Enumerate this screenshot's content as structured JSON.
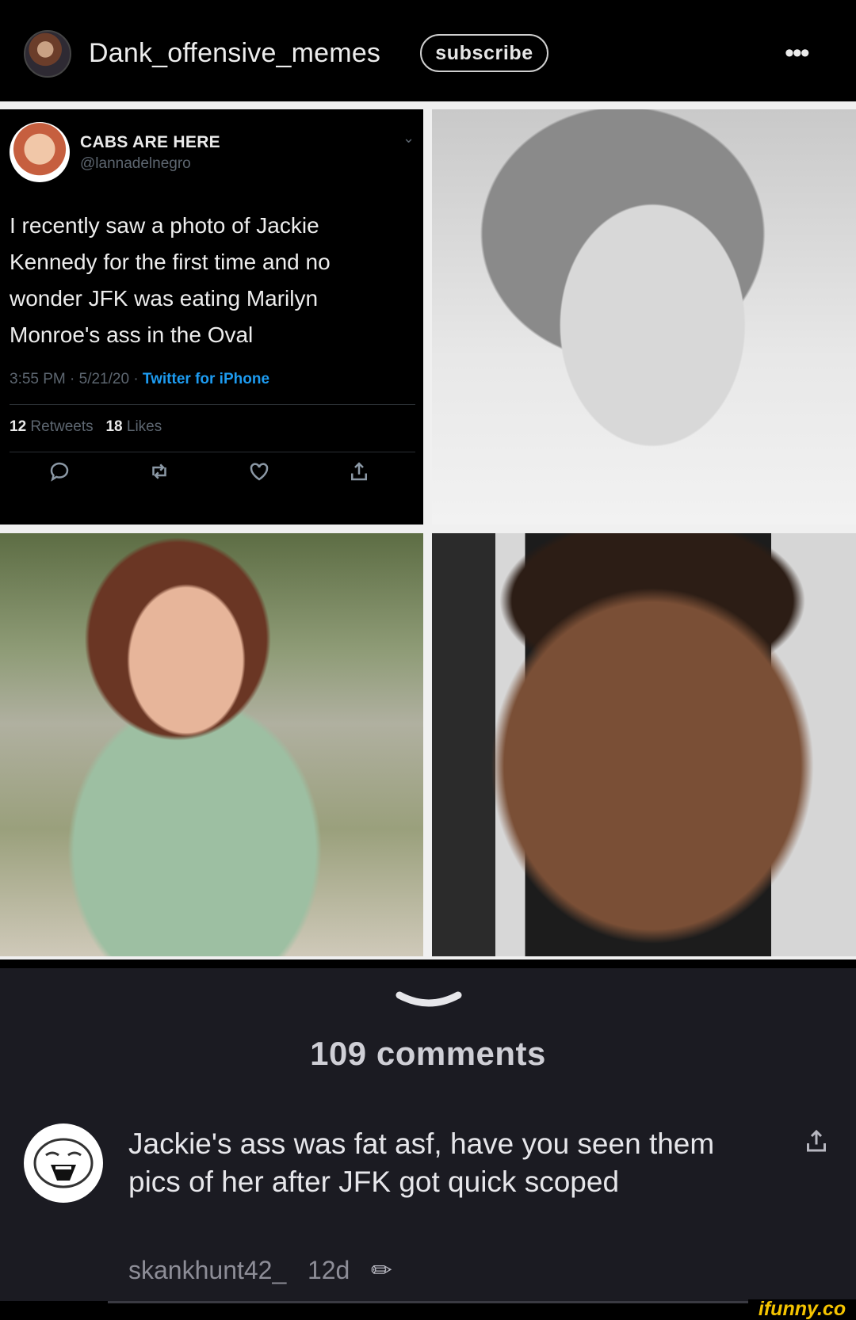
{
  "header": {
    "channel_name": "Dank_offensive_memes",
    "subscribe_label": "subscribe",
    "more_label": "•••"
  },
  "tweet": {
    "display_name": "CABS ARE HERE",
    "handle": "@lannadelnegro",
    "text": "I recently saw a photo of Jackie Kennedy for the first time and no wonder JFK was eating Marilyn Monroe's ass in the Oval",
    "time": "3:55 PM · 5/21/20 · ",
    "source": "Twitter for iPhone",
    "retweets_count": "12",
    "retweets_label": "Retweets",
    "likes_count": "18",
    "likes_label": "Likes"
  },
  "comments": {
    "count_label": "109 comments",
    "items": [
      {
        "text": "Jackie's ass was fat asf, have you seen them pics of her after JFK got quick scoped",
        "author": "skankhunt42_",
        "age": "12d"
      }
    ]
  },
  "watermark": "ifunny.co",
  "colors": {
    "background": "#000000",
    "sheet": "#1b1b22",
    "tweet_link": "#1d9bf0",
    "watermark": "#f5c400"
  }
}
